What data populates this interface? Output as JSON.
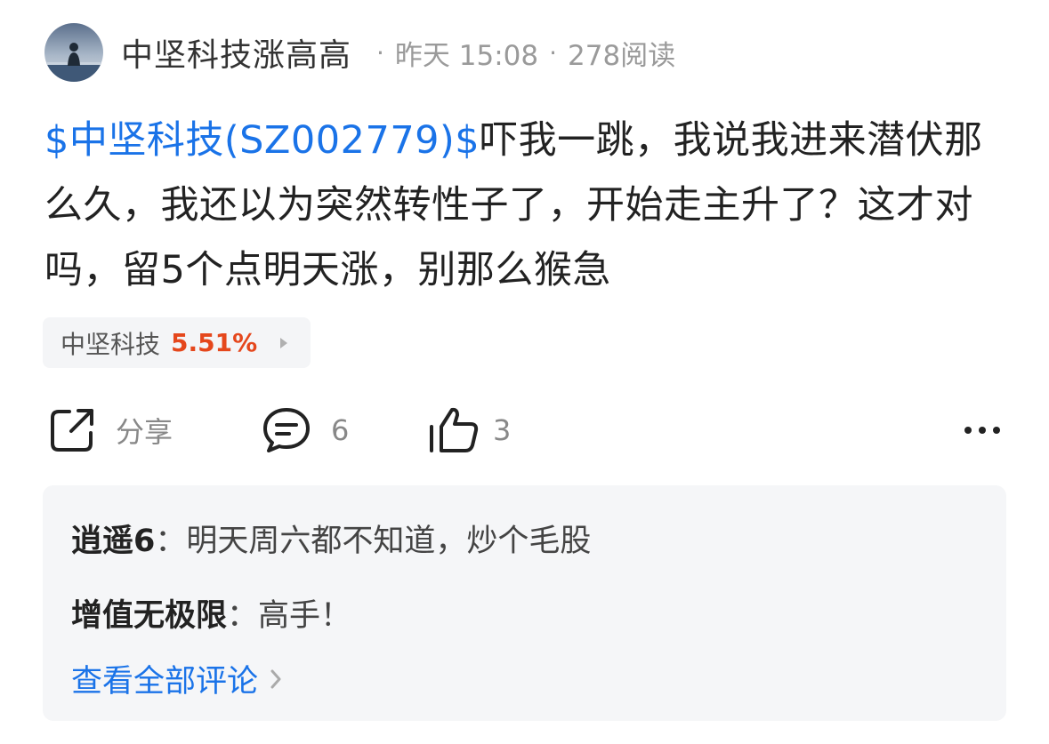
{
  "post": {
    "author": "中坚科技涨高高",
    "time": "昨天 15:08",
    "reads": "278阅读",
    "meta_separator": "·",
    "stock_link": "$中坚科技(SZ002779)$",
    "body": "吓我一跳，我说我进来潜伏那么久，我还以为突然转性子了，开始走主升了？这才对吗，留5个点明天涨，别那么猴急"
  },
  "stock_tag": {
    "name": "中坚科技",
    "change": "5.51%",
    "change_color": "#e5471c"
  },
  "actions": {
    "share_label": "分享",
    "comment_count": "6",
    "like_count": "3"
  },
  "comments": [
    {
      "author": "逍遥6",
      "separator": "：",
      "text": "明天周六都不知道，炒个毛股"
    },
    {
      "author": "增值无极限",
      "separator": "：",
      "text": "高手！"
    }
  ],
  "view_all_label": "查看全部评论",
  "colors": {
    "link": "#1a73e8",
    "muted": "#9a9a9a",
    "panel_bg": "#f5f6f8"
  },
  "icons": [
    "avatar-photo",
    "share-icon",
    "comment-icon",
    "thumbs-up-icon",
    "more-icon",
    "chevron-right-icon",
    "play-arrow-icon"
  ]
}
